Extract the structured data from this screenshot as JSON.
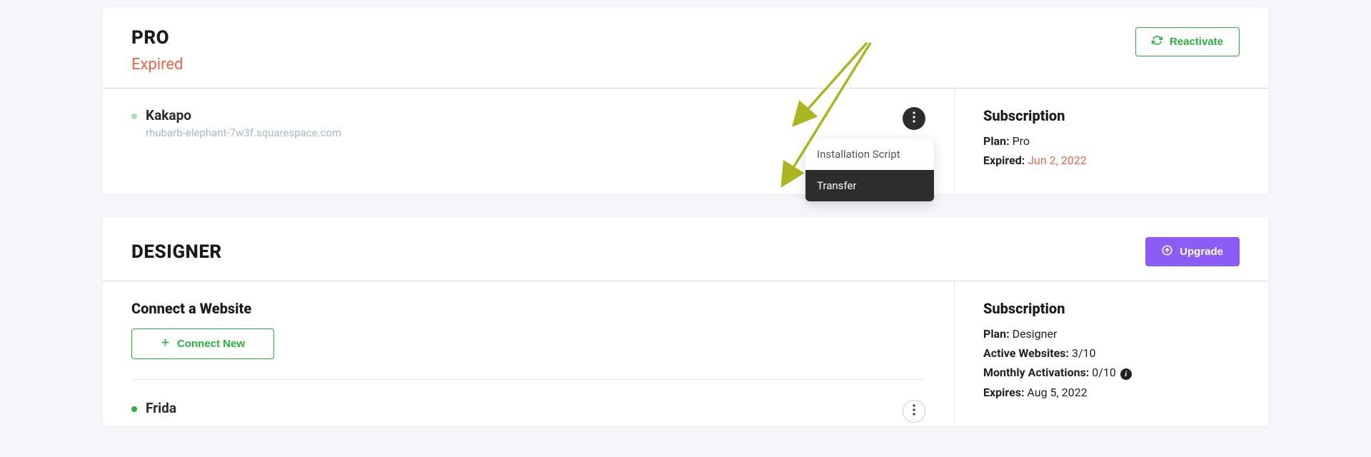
{
  "cards": {
    "pro": {
      "title": "PRO",
      "status": "Expired",
      "action_label": "Reactivate",
      "site": {
        "name": "Kakapo",
        "domain": "rhubarb-elephant-7w3f.squarespace.com"
      },
      "dropdown": {
        "item1": "Installation Script",
        "item2": "Transfer"
      },
      "subscription": {
        "heading": "Subscription",
        "plan_label": "Plan:",
        "plan_value": "Pro",
        "expired_label": "Expired:",
        "expired_value": "Jun 2, 2022"
      }
    },
    "designer": {
      "title": "DESIGNER",
      "action_label": "Upgrade",
      "connect": {
        "heading": "Connect a Website",
        "button": "Connect New"
      },
      "site": {
        "name": "Frida"
      },
      "subscription": {
        "heading": "Subscription",
        "plan_label": "Plan:",
        "plan_value": "Designer",
        "active_label": "Active Websites:",
        "active_value": "3/10",
        "monthly_label": "Monthly Activations:",
        "monthly_value": "0/10",
        "expires_label": "Expires:",
        "expires_value": "Aug 5, 2022"
      }
    }
  }
}
